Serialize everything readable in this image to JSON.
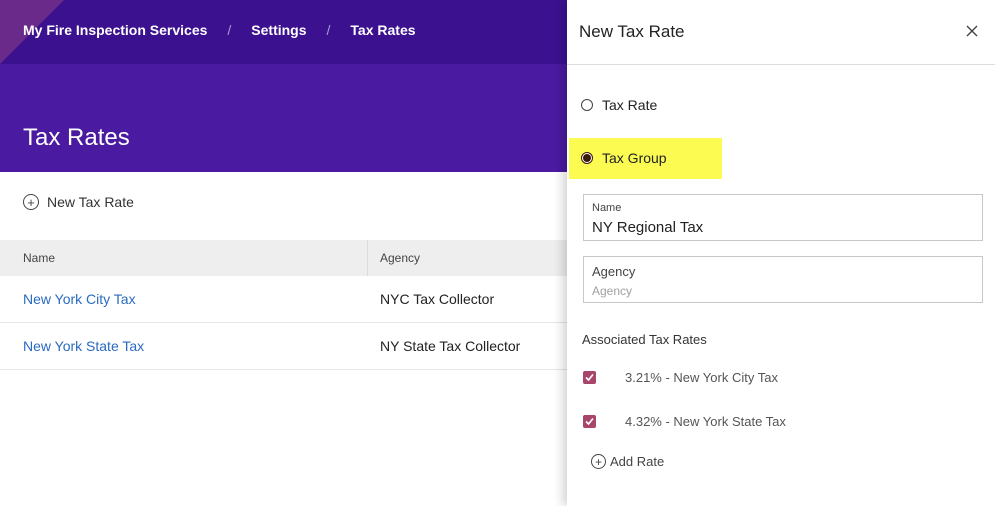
{
  "breadcrumb": {
    "items": [
      "My Fire Inspection Services",
      "Settings",
      "Tax Rates"
    ],
    "separator": "/"
  },
  "page": {
    "title": "Tax Rates",
    "new_button_label": "New Tax Rate"
  },
  "table": {
    "columns": [
      "Name",
      "Agency"
    ],
    "rows": [
      {
        "name": "New York City Tax",
        "agency": "NYC Tax Collector"
      },
      {
        "name": "New York State Tax",
        "agency": "NY State Tax Collector"
      }
    ]
  },
  "panel": {
    "title": "New Tax Rate",
    "close_icon": "close-icon",
    "type_options": {
      "tax_rate": "Tax Rate",
      "tax_group": "Tax Group",
      "selected": "Tax Group"
    },
    "name_field": {
      "label": "Name",
      "value": "NY Regional Tax"
    },
    "agency_field": {
      "label": "Agency",
      "placeholder": "Agency"
    },
    "associated": {
      "title": "Associated Tax Rates",
      "items": [
        "3.21% - New York City Tax",
        "4.32% - New York State Tax"
      ]
    },
    "add_rate_label": "Add Rate"
  },
  "colors": {
    "header_dark": "#3c1190",
    "header": "#4a1aa0",
    "link": "#2a6bbf",
    "checkbox": "#a8456a",
    "highlight": "#fbfb52"
  }
}
